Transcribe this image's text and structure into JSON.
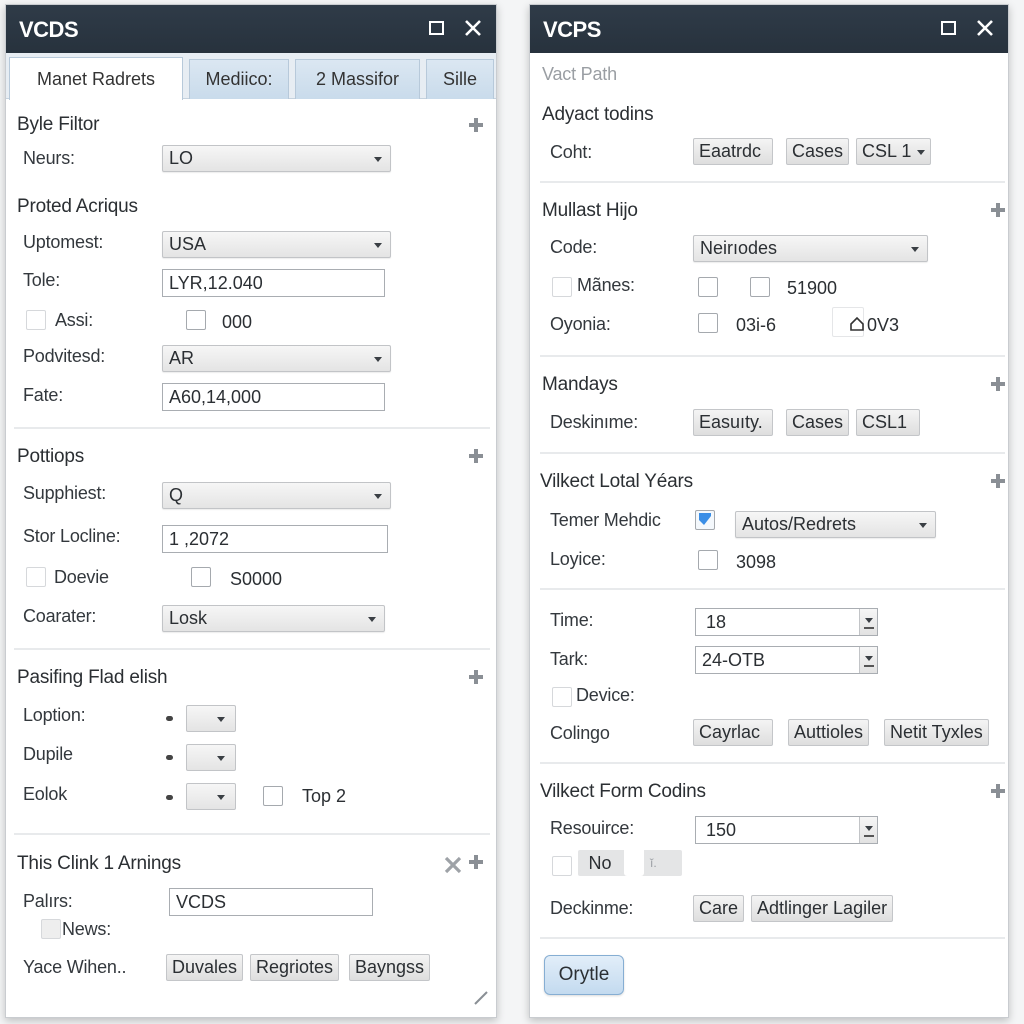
{
  "left_window": {
    "title": "VCDS",
    "tabs": [
      {
        "label": "Manet Radrets",
        "active": true
      },
      {
        "label": "Mediico:",
        "active": false
      },
      {
        "label": "2 Massifor",
        "active": false
      },
      {
        "label": "Sille",
        "active": false
      }
    ],
    "byle_filtor": {
      "title": "Byle Filtor",
      "neurs_label": "Neurs:",
      "neurs_value": "LO"
    },
    "proted_acriqus": {
      "title": "Proted Acriqus",
      "uptomest_label": "Uptomest:",
      "uptomest_value": "USA",
      "tole_label": "Tole:",
      "tole_value": "LYR,12.040",
      "assi_label": "Assi:",
      "assi_checked": false,
      "ooo_label": "000",
      "ooo_checked": false,
      "podvitesd_label": "Podvitesd:",
      "podvitesd_value": "AR",
      "fate_label": "Fate:",
      "fate_value": "A60,14,000"
    },
    "pottiops": {
      "title": "Pottiops",
      "supphiest_label": "Supphiest:",
      "supphiest_value": "Q",
      "stor_locline_label": "Stor Locline:",
      "stor_locline_value": "1 ,2072",
      "doevie_label": "Doevie",
      "doevie_checked": false,
      "s0000_label": "S0000",
      "s0000_checked": false,
      "coarater_label": "Coarater:",
      "coarater_value": "Losk"
    },
    "pasifing": {
      "title": "Pasifing Flad elish",
      "loption_label": "Loption:",
      "loption_value": "",
      "dupile_label": "Dupile",
      "dupile_value": "",
      "eolok_label": "Eolok",
      "eolok_value": "",
      "top2_label": "Top 2",
      "top2_checked": false
    },
    "this_clink": {
      "title": "This Clink 1 Arnings",
      "palirs_label": "Palırs:",
      "palirs_value": "VCDS",
      "news_label": "News:",
      "news_checked": false,
      "yace_label": "Yace Wihen..",
      "buttons": [
        "Duvales",
        "Regriotes",
        "Bayngss"
      ]
    }
  },
  "right_window": {
    "title": "VCPS",
    "vact_path": "Vact Path",
    "adyact": {
      "title": "Adyact todins",
      "coht_label": "Coht:",
      "buttons": [
        "Eaatrdc",
        "Cases"
      ],
      "dropdown_button": "CSL 1"
    },
    "mullast": {
      "title": "Mullast Hijo",
      "code_label": "Code:",
      "code_value": "Neirıodes",
      "manes_label": "Mãnes:",
      "manes_checked": false,
      "manes_check2": false,
      "value_51900": "51900",
      "value_51900_checked": false,
      "oyonia_label": "Oyonia:",
      "oyonia_checked": false,
      "oyonia_value": "03i-6",
      "ov3_value": "0V3"
    },
    "mandays": {
      "title": "Mandays",
      "deskinime_label": "Deskinıme:",
      "buttons": [
        "Easuıty.",
        "Cases",
        "CSL1"
      ]
    },
    "vilkect_lotal": {
      "title": "Vilkect Lotal Yéars",
      "temer_label": "Temer Mehdic",
      "temer_checked": true,
      "temer_value": "Autos/Redrets",
      "loyice_label": "Loyice:",
      "loyice_checked": false,
      "loyice_value": "3098"
    },
    "time_section": {
      "time_label": "Time:",
      "time_value": "18",
      "tark_label": "Tark:",
      "tark_value": "24-OTB",
      "device_label": "Device:",
      "device_checked": false,
      "colingo_label": "Colingo",
      "buttons": [
        "Cayrlac",
        "Auttioles",
        "Netit Tyxles"
      ]
    },
    "vilkect_form": {
      "title": "Vilkect Form Codins",
      "resouirce_label": "Resouirce:",
      "resouirce_value": "150",
      "no_checked": false,
      "toggle_label": "No",
      "deckinme_label": "Deckinme:",
      "buttons": [
        "Care",
        "Adtlinger Lagiler"
      ]
    },
    "primary_button": "Orytle"
  },
  "colors": {
    "titlebar": "#2b3642",
    "tab_inactive": "#d0e0ee",
    "accent_check": "#3a8ee6",
    "primary_button": "#cfe2f3"
  }
}
